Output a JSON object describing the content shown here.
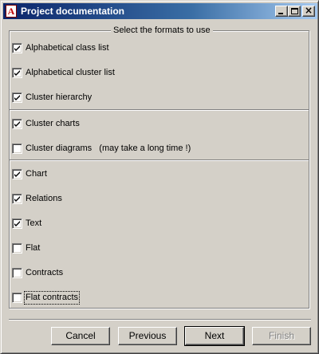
{
  "window": {
    "title": "Project documentation",
    "icon": "app-a-icon"
  },
  "group": {
    "legend": "Select the formats to use"
  },
  "options": [
    {
      "label": "Alphabetical class list",
      "checked": true
    },
    {
      "label": "Alphabetical cluster list",
      "checked": true
    },
    {
      "label": "Cluster hierarchy",
      "checked": true
    },
    {
      "label": "Cluster charts",
      "checked": true
    },
    {
      "label": "Cluster diagrams   (may take a long time !)",
      "checked": false
    },
    {
      "label": "Chart",
      "checked": true
    },
    {
      "label": "Relations",
      "checked": true
    },
    {
      "label": "Text",
      "checked": true
    },
    {
      "label": "Flat",
      "checked": false
    },
    {
      "label": "Contracts",
      "checked": false
    },
    {
      "label": "Flat contracts",
      "checked": false
    }
  ],
  "buttons": {
    "cancel": "Cancel",
    "previous": "Previous",
    "next": "Next",
    "finish": "Finish"
  }
}
